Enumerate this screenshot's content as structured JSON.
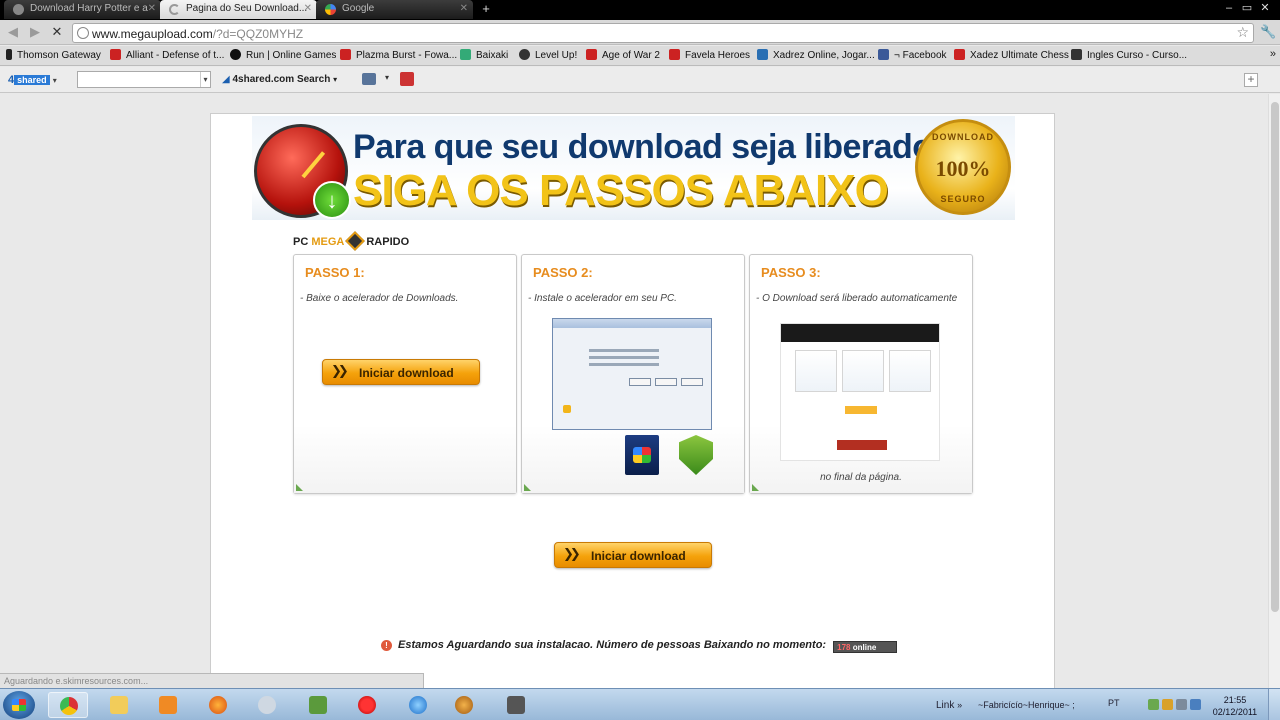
{
  "browser": {
    "tabs": [
      {
        "label": "Download Harry Potter e a"
      },
      {
        "label": "Pagina do Seu Download..."
      },
      {
        "label": "Google"
      }
    ],
    "url_host": "www.megaupload.com",
    "url_rest": "/?d=QQZ0MYHZ",
    "bookmarks": [
      {
        "label": "Thomson Gateway"
      },
      {
        "label": "Alliant - Defense of t..."
      },
      {
        "label": "Run | Online Games"
      },
      {
        "label": "Plazma Burst - Fowa..."
      },
      {
        "label": "Baixaki"
      },
      {
        "label": "Level Up!"
      },
      {
        "label": "Age of War 2"
      },
      {
        "label": "Favela Heroes"
      },
      {
        "label": "Xadrez Online, Jogar..."
      },
      {
        "label": "¬ Facebook"
      },
      {
        "label": "Xadez Ultimate Chess"
      },
      {
        "label": "Ingles Curso - Curso..."
      }
    ],
    "addon": {
      "brand_4": "4",
      "brand_shared": "shared",
      "search_label": "4shared.com Search"
    },
    "status_text": "Aguardando e.skimresources.com..."
  },
  "page": {
    "banner": {
      "headline": "Para que seu download seja liberado!",
      "subheadline": "SIGA OS PASSOS ABAIXO",
      "seal_top": "DOWNLOAD",
      "seal_pct": "100%",
      "seal_bottom": "SEGURO"
    },
    "brand": {
      "pc": "PC",
      "mega": "MEGA",
      "rapido": "RAPIDO"
    },
    "steps": [
      {
        "title": "PASSO 1:",
        "desc": "- Baixe o acelerador de Downloads."
      },
      {
        "title": "PASSO 2:",
        "desc": "- Instale o acelerador em seu PC."
      },
      {
        "title": "PASSO 3:",
        "desc": "- O Download será liberado automaticamente",
        "after": "no final da página."
      }
    ],
    "download_button": "Iniciar download",
    "waiting_note": "Estamos Aguardando sua instalacao. Número de pessoas Baixando no momento:",
    "counter": {
      "value": "178",
      "label": "online"
    }
  },
  "taskbar": {
    "link_label": "Link",
    "user": "~Fabricícío~Henrique~ ;",
    "lang": "PT",
    "time": "21:55",
    "date": "02/12/2011"
  },
  "colors": {
    "accent_orange": "#e78c1e",
    "banner_blue": "#10396e",
    "banner_yellow": "#f2c318"
  }
}
